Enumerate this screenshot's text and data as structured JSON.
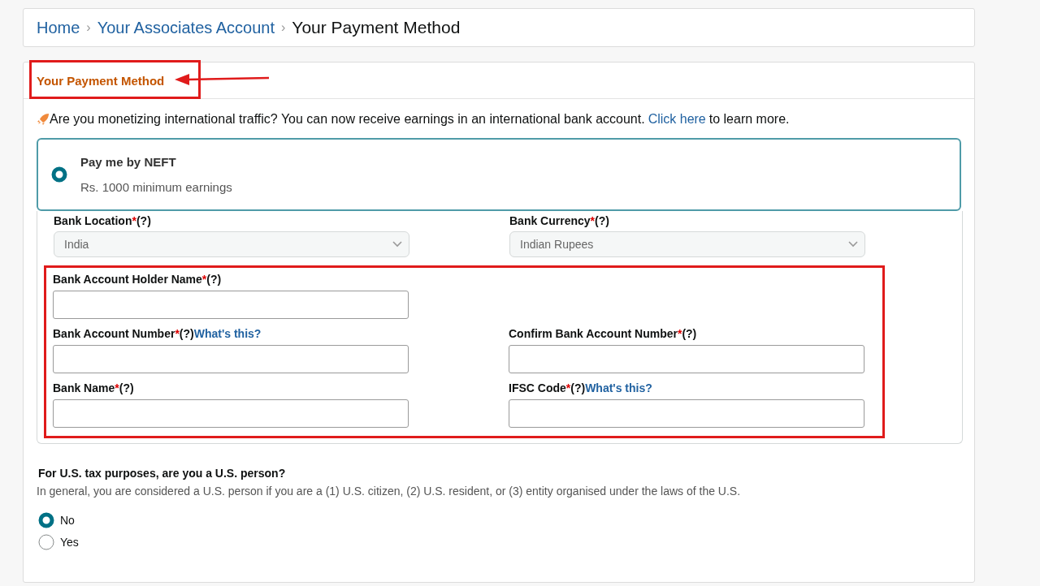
{
  "breadcrumb": [
    {
      "label": "Home",
      "current": false
    },
    {
      "label": "Your Associates Account",
      "current": false
    },
    {
      "label": "Your Payment Method",
      "current": true
    }
  ],
  "breadcrumb_separator": "›",
  "section_title": "Your Payment Method",
  "notice": {
    "text": "Are you monetizing international traffic? You can now receive earnings in an international bank account.",
    "link": "Click here",
    "after": "to learn more."
  },
  "payment_option": {
    "title": "Pay me by NEFT",
    "subtitle": "Rs. 1000 minimum earnings",
    "selected": true
  },
  "fields": [
    {
      "kind": "select",
      "label": "Bank Location",
      "mark": "*",
      "help": "(?)",
      "value": "India"
    },
    {
      "kind": "select",
      "label": "Bank Currency",
      "mark": "*",
      "help": "(?)",
      "value": "Indian Rupees"
    }
  ],
  "highlighted_fields": [
    {
      "kind": "text",
      "label": "Bank Account Holder Name",
      "mark": "*",
      "help": "(?)"
    },
    {
      "kind": "empty"
    },
    {
      "kind": "text",
      "label": "Bank Account Number",
      "mark": "*",
      "help": "(?)",
      "link": "What's this?"
    },
    {
      "kind": "text",
      "label": "Confirm Bank Account Number",
      "mark": "*",
      "help": "(?)"
    },
    {
      "kind": "text",
      "label": "Bank Name",
      "mark": "*",
      "help": "(?)"
    },
    {
      "kind": "text",
      "label": "IFSC Code",
      "mark": "*",
      "help": "(?)",
      "link": "What's this?"
    }
  ],
  "tax": {
    "question": "For U.S. tax purposes, are you a U.S. person?",
    "hint": "In general, you are considered a U.S. person if you are a (1) U.S. citizen, (2) U.S. resident, or (3) entity organised under the laws of the U.S.",
    "options": [
      {
        "label": "No",
        "selected": true
      },
      {
        "label": "Yes",
        "selected": false
      }
    ]
  }
}
